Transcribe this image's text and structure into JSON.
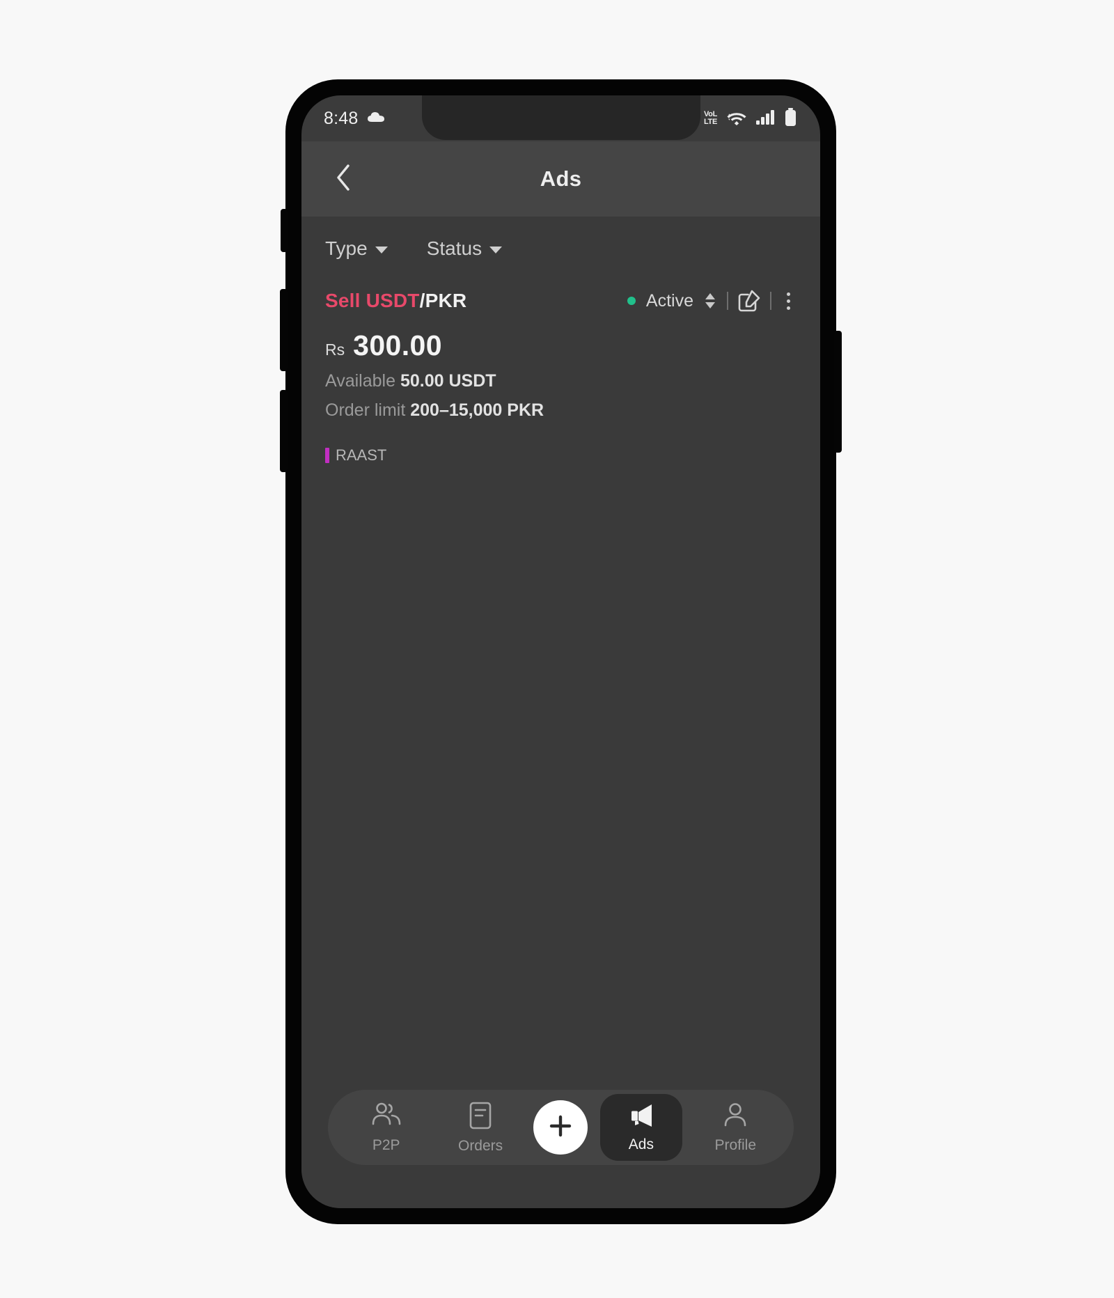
{
  "status_bar": {
    "time": "8:48",
    "weather_icon": "cloud-icon",
    "volte_line1": "VoL",
    "volte_line2": "LTE",
    "icons": [
      "volte-icon",
      "wifi-icon",
      "cellular-signal-icon",
      "battery-icon"
    ]
  },
  "app_bar": {
    "back_icon": "back-chevron-icon",
    "title": "Ads"
  },
  "filters": [
    {
      "label": "Type",
      "icon": "chevron-down-icon"
    },
    {
      "label": "Status",
      "icon": "chevron-down-icon"
    }
  ],
  "ads": [
    {
      "side": "Sell",
      "base_asset": "USDT",
      "separator": "/",
      "quote_asset": "PKR",
      "status": "Active",
      "status_color": "#21c08b",
      "actions": [
        "sort-arrows-icon",
        "edit-icon",
        "more-options-icon"
      ],
      "price_currency": "Rs",
      "price_value": "300.00",
      "available_label": "Available",
      "available_value": "50.00 USDT",
      "order_limit_label": "Order limit",
      "order_limit_value": "200–15,000 PKR",
      "payment_methods": [
        {
          "name": "RAAST",
          "color": "#c12ec1"
        }
      ]
    }
  ],
  "bottom_nav": {
    "items": [
      {
        "label": "P2P",
        "icon": "people-icon",
        "active": false
      },
      {
        "label": "Orders",
        "icon": "document-list-icon",
        "active": false
      },
      {
        "label": "Ads",
        "icon": "megaphone-icon",
        "active": true
      },
      {
        "label": "Profile",
        "icon": "person-icon",
        "active": false
      }
    ],
    "fab_icon": "plus-icon"
  },
  "theme": {
    "screen_bg": "#3a3a3a",
    "app_bar_bg": "#454545",
    "accent_sell": "#e8496a",
    "accent_active": "#21c08b",
    "accent_raast": "#c12ec1"
  }
}
